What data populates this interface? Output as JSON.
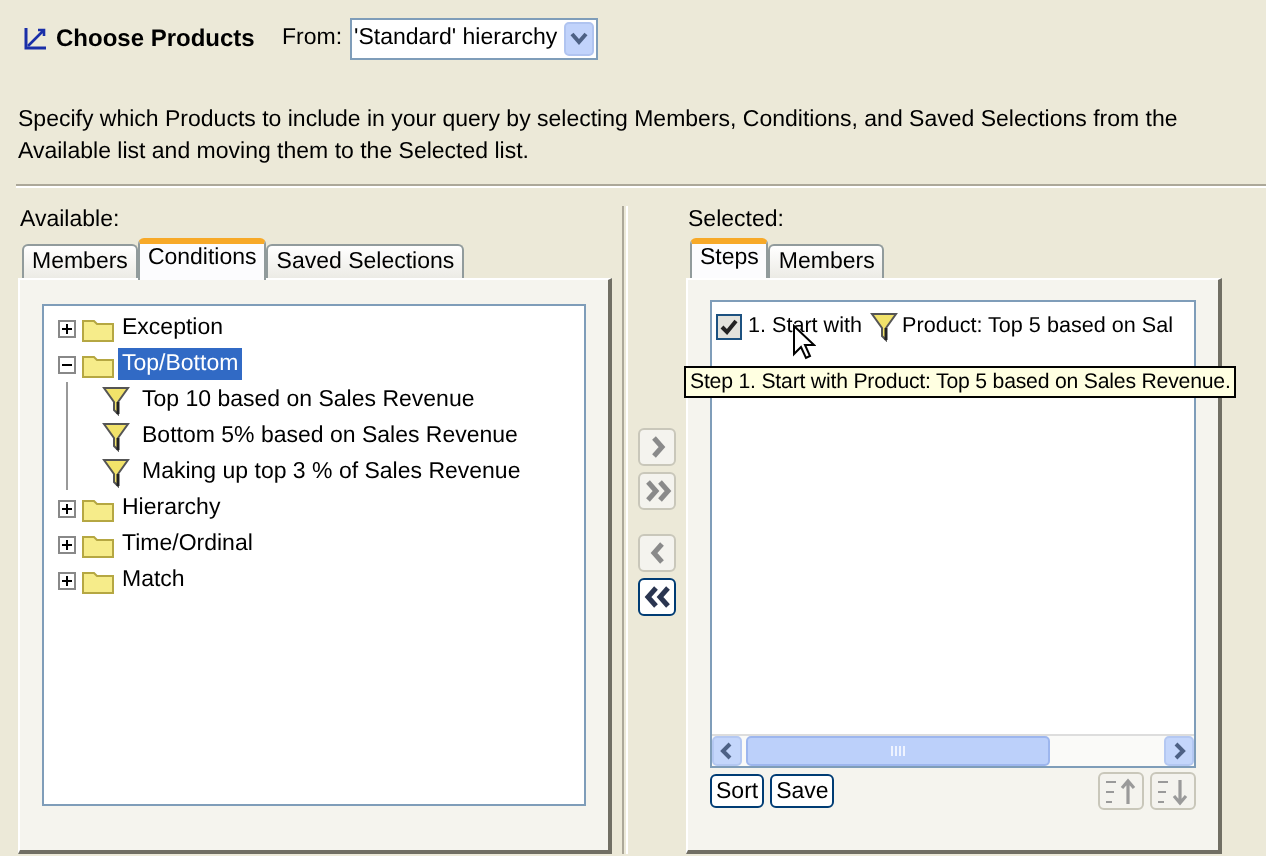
{
  "header": {
    "title": "Choose Products",
    "from_label": "From:",
    "hierarchy": "'Standard' hierarchy"
  },
  "description": "Specify which Products to include in your query by selecting Members, Conditions, and Saved Selections from the Available list and moving them to the Selected list.",
  "available": {
    "label": "Available:",
    "tabs": [
      {
        "label": "Members",
        "selected": false
      },
      {
        "label": "Conditions",
        "selected": true
      },
      {
        "label": "Saved Selections",
        "selected": false
      }
    ],
    "tree": [
      {
        "label": "Exception",
        "expanded": false,
        "selected": false
      },
      {
        "label": "Top/Bottom",
        "expanded": true,
        "selected": true,
        "children": [
          {
            "label": "Top 10 based on Sales Revenue",
            "selected": false
          },
          {
            "label": "Bottom 5% based on Sales Revenue",
            "selected": false
          },
          {
            "label": "Making up top 3 % of Sales Revenue",
            "selected": false
          }
        ]
      },
      {
        "label": "Hierarchy",
        "expanded": false,
        "selected": false
      },
      {
        "label": "Time/Ordinal",
        "expanded": false,
        "selected": false
      },
      {
        "label": "Match",
        "expanded": false,
        "selected": false
      }
    ]
  },
  "move_buttons": [
    {
      "kind": "add",
      "disabled": true
    },
    {
      "kind": "add_all",
      "disabled": true
    },
    {
      "kind": "remove",
      "disabled": true
    },
    {
      "kind": "remove_all",
      "disabled": false
    }
  ],
  "selected": {
    "label": "Selected:",
    "tabs": [
      {
        "label": "Steps",
        "selected": true
      },
      {
        "label": "Members",
        "selected": false
      }
    ],
    "steps": [
      {
        "checked": true,
        "label": "1. Start with",
        "condition": "Product: Top 5 based on Sal"
      }
    ],
    "tooltip": "Step 1. Start with Product: Top 5 based on Sales Revenue.",
    "buttons": [
      "Sort",
      "Save"
    ],
    "order_buttons": [
      {
        "kind": "up",
        "disabled": true
      },
      {
        "kind": "down",
        "disabled": true
      }
    ]
  }
}
